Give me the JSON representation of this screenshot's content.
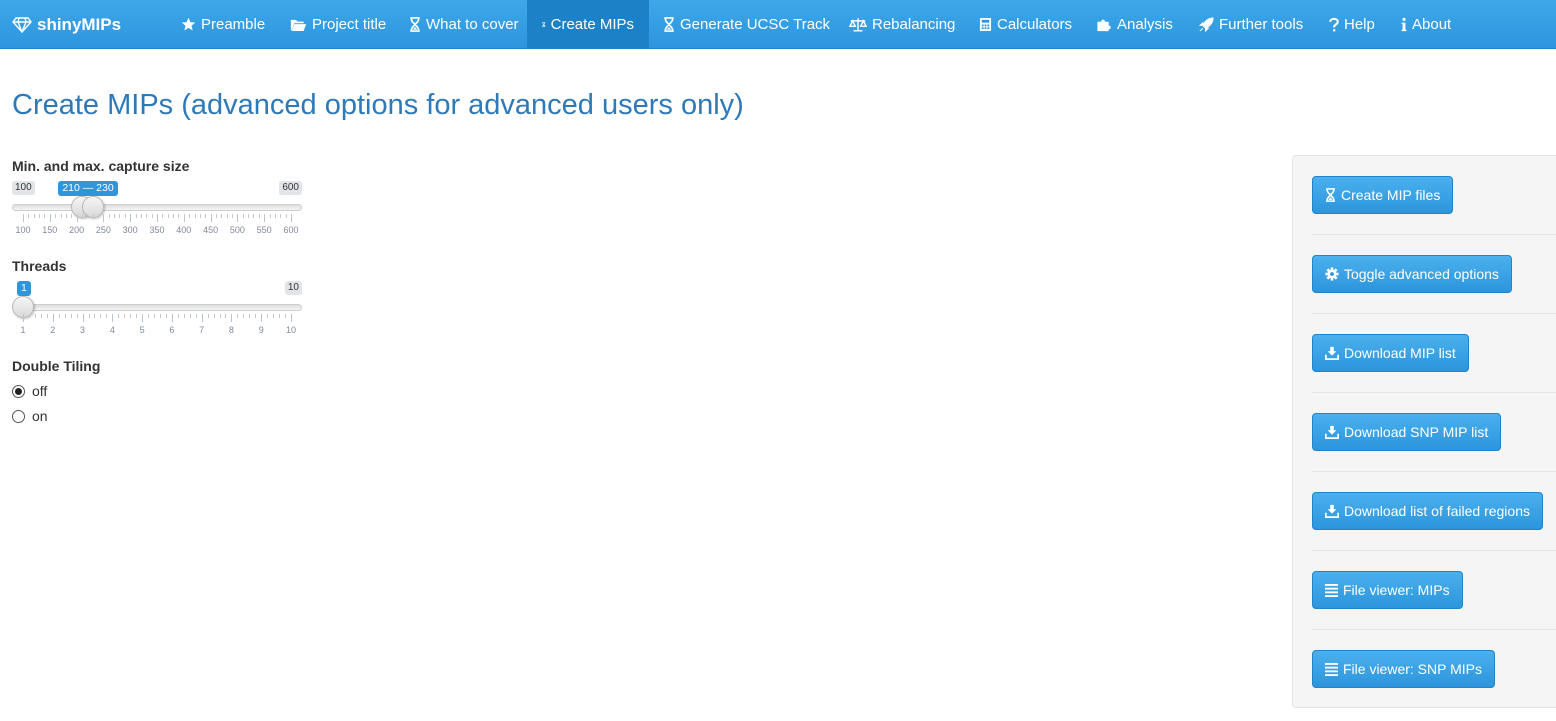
{
  "app": {
    "brand": "shinyMIPs"
  },
  "nav": [
    {
      "label": "Preamble",
      "icon": "star-icon"
    },
    {
      "label": "Project title",
      "icon": "folder-open-icon"
    },
    {
      "label": "What to cover",
      "icon": "hourglass-icon"
    },
    {
      "label": "Create MIPs",
      "icon": "hourglass-icon",
      "active": true
    },
    {
      "label": "Generate UCSC Track",
      "icon": "hourglass-icon"
    },
    {
      "label": "Rebalancing",
      "icon": "balance-scale-icon"
    },
    {
      "label": "Calculators",
      "icon": "calculator-icon"
    },
    {
      "label": "Analysis",
      "icon": "puzzle-piece-icon"
    },
    {
      "label": "Further tools",
      "icon": "rocket-icon"
    },
    {
      "label": "Help",
      "icon": "question-icon"
    },
    {
      "label": "About",
      "icon": "info-icon"
    }
  ],
  "page": {
    "title": "Create MIPs (advanced options for advanced users only)"
  },
  "capture_size": {
    "label": "Min. and max. capture size",
    "min_label": "100",
    "max_label": "600",
    "range_label": "210 — 230",
    "min": 100,
    "max": 600,
    "from": 210,
    "to": 230,
    "step_major": 50,
    "ticks": [
      "100",
      "150",
      "200",
      "250",
      "300",
      "350",
      "400",
      "450",
      "500",
      "550",
      "600"
    ]
  },
  "threads": {
    "label": "Threads",
    "min_label": "1",
    "max_label": "10",
    "value_label": "1",
    "min": 1,
    "max": 10,
    "value": 1,
    "ticks": [
      "1",
      "2",
      "3",
      "4",
      "5",
      "6",
      "7",
      "8",
      "9",
      "10"
    ]
  },
  "double_tiling": {
    "label": "Double Tiling",
    "options": [
      "off",
      "on"
    ],
    "selected": "off"
  },
  "side_buttons": [
    {
      "label": "Create MIP files",
      "icon": "hourglass-icon"
    },
    {
      "label": "Toggle advanced options",
      "icon": "gear-icon"
    },
    {
      "label": "Download MIP list",
      "icon": "download-icon"
    },
    {
      "label": "Download SNP MIP list",
      "icon": "download-icon"
    },
    {
      "label": "Download list of failed regions",
      "icon": "download-icon"
    },
    {
      "label": "File viewer: MIPs",
      "icon": "list-icon"
    },
    {
      "label": "File viewer: SNP MIPs",
      "icon": "list-icon"
    }
  ],
  "colors": {
    "navbar": "#2d95dd",
    "active_tab": "#1c81c6",
    "accent": "#2f96dc",
    "title": "#2e7ab8"
  }
}
